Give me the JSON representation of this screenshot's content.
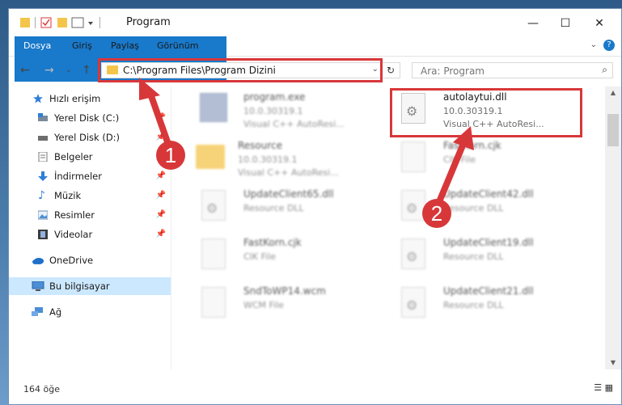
{
  "window": {
    "title": "Program",
    "controls": {
      "minimize": "—",
      "maximize": "☐",
      "close": "✕"
    }
  },
  "ribbon": {
    "tabs": [
      {
        "label": "Dosya"
      },
      {
        "label": "Giriş"
      },
      {
        "label": "Paylaş"
      },
      {
        "label": "Görünüm"
      }
    ],
    "help": "?"
  },
  "nav": {
    "address": "C:\\Program Files\\Program Dizini",
    "search_placeholder": "Ara: Program"
  },
  "sidebar": {
    "items": [
      {
        "label": "Hızlı erişim"
      },
      {
        "label": "Yerel Disk (C:)"
      },
      {
        "label": "Yerel Disk (D:)"
      },
      {
        "label": "Belgeler"
      },
      {
        "label": "İndirmeler"
      },
      {
        "label": "Müzik"
      },
      {
        "label": "Resimler"
      },
      {
        "label": "Videolar"
      },
      {
        "label": "OneDrive"
      },
      {
        "label": "Bu bilgisayar"
      },
      {
        "label": "Ağ"
      }
    ]
  },
  "files": [
    {
      "name": "program.exe",
      "version": "10.0.30319.1",
      "desc": "Visual C++ AutoResi..."
    },
    {
      "name": "autolaytui.dll",
      "version": "10.0.30319.1",
      "desc": "Visual C++ AutoResi..."
    },
    {
      "name": "Resource",
      "version": "10.0.30319.1",
      "desc": "Visual C++ AutoResi..."
    },
    {
      "name": "FastKorn.cjk",
      "version": "CIK File",
      "desc": ""
    },
    {
      "name": "UpdateClient65.dll",
      "version": "Resource DLL",
      "desc": ""
    },
    {
      "name": "UpdateClient42.dll",
      "version": "Resource DLL",
      "desc": ""
    },
    {
      "name": "FastKorn.cjk",
      "version": "CIK File",
      "desc": ""
    },
    {
      "name": "UpdateClient19.dll",
      "version": "Resource DLL",
      "desc": ""
    },
    {
      "name": "SndToWP14.wcm",
      "version": "WCM File",
      "desc": ""
    },
    {
      "name": "UpdateClient21.dll",
      "version": "Resource DLL",
      "desc": ""
    }
  ],
  "status": {
    "count": "164 öğe"
  },
  "annotations": {
    "badge1": "1",
    "badge2": "2",
    "color": "#d8373a"
  }
}
